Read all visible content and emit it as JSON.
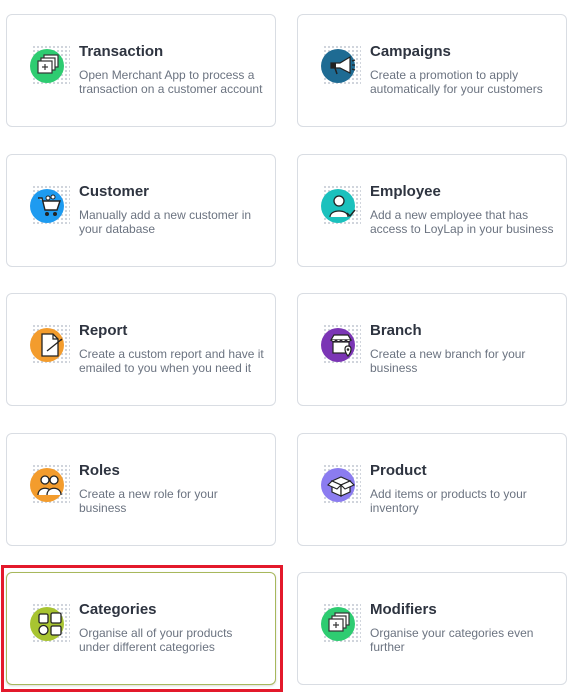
{
  "cards": [
    {
      "title": "Transaction",
      "description": "Open Merchant App to process a transaction on a customer account",
      "icon": "transaction-icon",
      "color": "#2ecc71"
    },
    {
      "title": "Campaigns",
      "description": "Create a promotion to apply automatically for your customers",
      "icon": "megaphone-icon",
      "color": "#1e6b93"
    },
    {
      "title": "Customer",
      "description": "Manually add a new customer in your database",
      "icon": "shopping-cart-icon",
      "color": "#1e9bf0"
    },
    {
      "title": "Employee",
      "description": "Add a new employee that has access to LoyLap in your business",
      "icon": "employee-icon",
      "color": "#1bc1bd"
    },
    {
      "title": "Report",
      "description": "Create a custom report and have it emailed to you when you need it",
      "icon": "report-icon",
      "color": "#f39c2d"
    },
    {
      "title": "Branch",
      "description": "Create a new branch for your business",
      "icon": "store-location-icon",
      "color": "#7b35b5"
    },
    {
      "title": "Roles",
      "description": "Create a new role for your business",
      "icon": "people-icon",
      "color": "#f39c2d"
    },
    {
      "title": "Product",
      "description": "Add items or products to your inventory",
      "icon": "box-icon",
      "color": "#8b7cf0"
    },
    {
      "title": "Categories",
      "description": "Organise all of your products under different categories",
      "icon": "categories-icon",
      "color": "#a8c431"
    },
    {
      "title": "Modifiers",
      "description": "Organise your categories even further",
      "icon": "modifiers-icon",
      "color": "#2ecc71"
    }
  ]
}
